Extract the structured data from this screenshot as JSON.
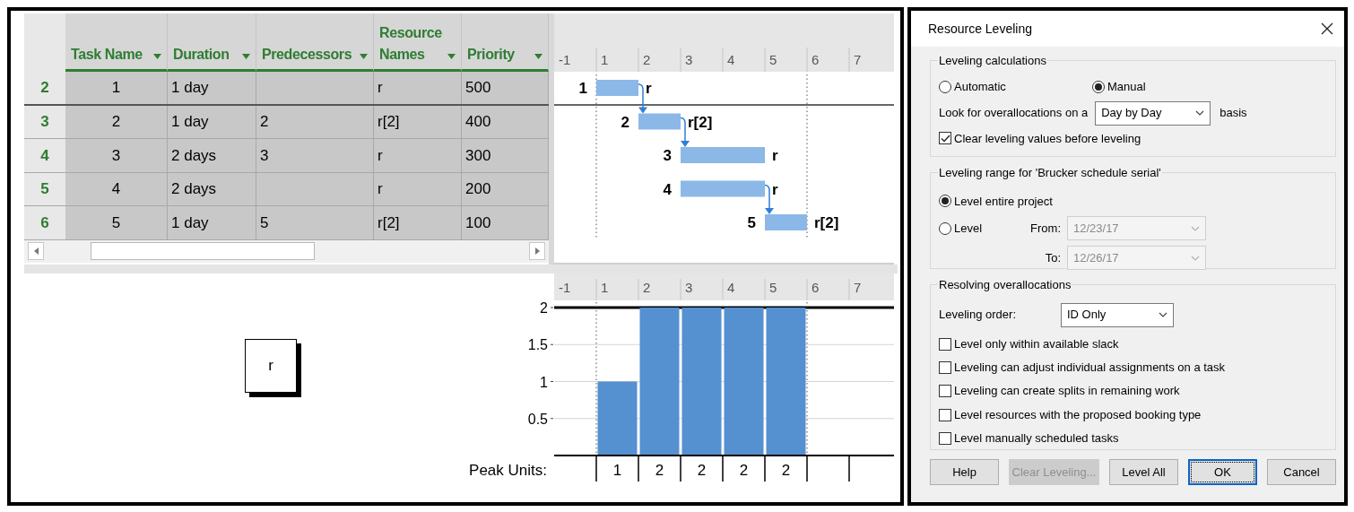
{
  "task_table": {
    "columns": [
      {
        "label": "Task Name"
      },
      {
        "label": "Duration"
      },
      {
        "label": "Predecessors"
      },
      {
        "label": "Resource Names"
      },
      {
        "label": "Priority"
      }
    ],
    "rows": [
      {
        "id": "2",
        "task_name": "1",
        "duration": "1 day",
        "resource_names": "r",
        "priority": "500",
        "selected": true
      },
      {
        "id": "3",
        "task_name": "2",
        "duration": "1 day",
        "predecessors": "2",
        "resource_names": "r[2]",
        "priority": "400",
        "selected": true
      },
      {
        "id": "4",
        "task_name": "3",
        "duration": "2 days",
        "predecessors": "3",
        "resource_names": "r",
        "priority": "300",
        "selected": true
      },
      {
        "id": "5",
        "task_name": "4",
        "duration": "2 days",
        "resource_names": "r",
        "priority": "200",
        "selected": true
      },
      {
        "id": "6",
        "task_name": "5",
        "duration": "1 day",
        "predecessors": "5",
        "resource_names": "r[2]",
        "priority": "100",
        "selected": true
      }
    ]
  },
  "gantt": {
    "timescale": [
      "-1",
      "1",
      "2",
      "3",
      "4",
      "5",
      "6",
      "7"
    ],
    "tasks": [
      {
        "label": "1",
        "resource": "r",
        "linked_from_previous": false,
        "bar_days": [
          false,
          true,
          false,
          false,
          false,
          false,
          false,
          false
        ]
      },
      {
        "label": "2",
        "resource": "r[2]",
        "linked_from_previous": true,
        "bar_days": [
          false,
          false,
          true,
          false,
          false,
          false,
          false,
          false
        ]
      },
      {
        "label": "3",
        "resource": "r",
        "linked_from_previous": true,
        "bar_days": [
          false,
          false,
          false,
          true,
          true,
          false,
          false,
          false
        ]
      },
      {
        "label": "4",
        "resource": "r",
        "linked_from_previous": false,
        "bar_days": [
          false,
          false,
          false,
          true,
          true,
          false,
          false,
          false
        ]
      },
      {
        "label": "5",
        "resource": "r[2]",
        "linked_from_previous": true,
        "bar_days": [
          false,
          false,
          false,
          false,
          false,
          true,
          false,
          false
        ]
      }
    ]
  },
  "resource_view": {
    "resource": "r",
    "graph": {
      "chart_data": {
        "type": "bar",
        "categories": [
          "-1",
          "1",
          "2",
          "3",
          "4",
          "5",
          "6",
          "7"
        ],
        "values": [
          null,
          1,
          2,
          2,
          2,
          2,
          null,
          null
        ],
        "ylim": [
          0,
          2
        ],
        "yticks": [
          0.5,
          1,
          1.5,
          2
        ],
        "grid": true
      },
      "peak_units": {
        "label": "Peak Units:",
        "values": [
          "1",
          "2",
          "2",
          "2",
          "2"
        ]
      }
    }
  },
  "dialog": {
    "title": "Resource Leveling",
    "calculations": {
      "title": "Leveling calculations",
      "options": [
        {
          "label": "Automatic",
          "selected": false
        },
        {
          "label": "Manual",
          "selected": true
        }
      ],
      "look_for": {
        "label": "Look for overallocations on a",
        "value": "Day by Day",
        "suffix": "basis"
      },
      "clear_values": {
        "label": "Clear leveling values before leveling",
        "checked": true
      }
    },
    "range": {
      "title": "Leveling range for 'Brucker schedule serial'",
      "options": [
        {
          "label": "Level entire project",
          "selected": true
        },
        {
          "label": "Level",
          "selected": false
        }
      ],
      "from": {
        "label": "From:",
        "value": "12/23/17",
        "disabled": true
      },
      "to": {
        "label": "To:",
        "value": "12/26/17",
        "disabled": true
      }
    },
    "resolving": {
      "title": "Resolving overallocations",
      "order": {
        "label": "Leveling order:",
        "value": "ID Only"
      },
      "checkboxes": [
        {
          "label": "Level only within available slack",
          "checked": false
        },
        {
          "label": "Leveling can adjust individual assignments on a task",
          "checked": false
        },
        {
          "label": "Leveling can create splits in remaining work",
          "checked": false
        },
        {
          "label": "Level resources with the proposed booking type",
          "checked": false
        },
        {
          "label": "Level manually scheduled tasks",
          "checked": false
        }
      ]
    },
    "buttons": [
      {
        "label": "Help",
        "disabled": false,
        "default": false
      },
      {
        "label": "Clear Leveling...",
        "disabled": true,
        "default": false
      },
      {
        "label": "Level All",
        "disabled": false,
        "default": false
      },
      {
        "label": "OK",
        "disabled": false,
        "default": true
      },
      {
        "label": "Cancel",
        "disabled": false,
        "default": false
      }
    ]
  }
}
